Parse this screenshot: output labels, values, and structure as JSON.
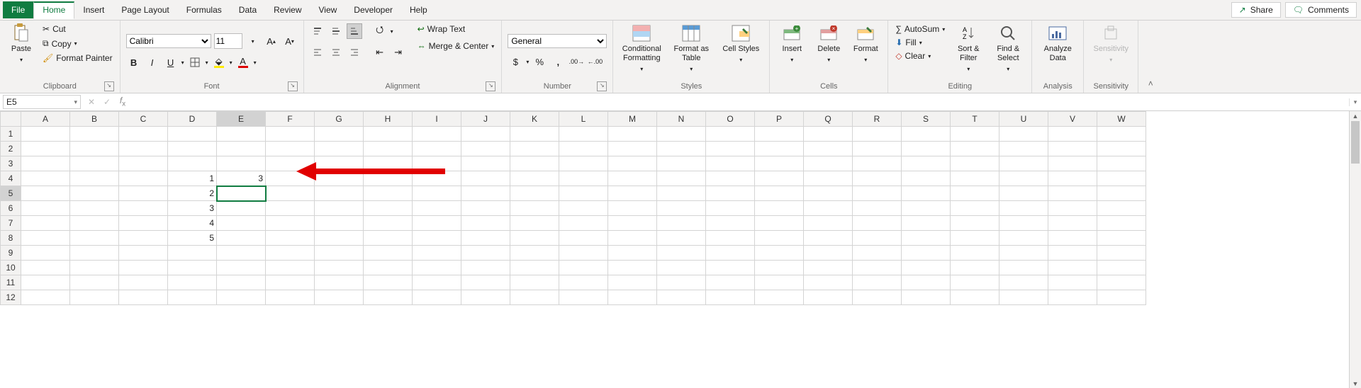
{
  "tabs": {
    "file": "File",
    "home": "Home",
    "insert": "Insert",
    "pagelayout": "Page Layout",
    "formulas": "Formulas",
    "data": "Data",
    "review": "Review",
    "view": "View",
    "developer": "Developer",
    "help": "Help"
  },
  "share": "Share",
  "comments": "Comments",
  "clipboard": {
    "paste": "Paste",
    "cut": "Cut",
    "copy": "Copy",
    "formatpainter": "Format Painter",
    "label": "Clipboard"
  },
  "font": {
    "name": "Calibri",
    "size": "11",
    "label": "Font"
  },
  "alignment": {
    "wrap": "Wrap Text",
    "merge": "Merge & Center",
    "label": "Alignment"
  },
  "number": {
    "format": "General",
    "label": "Number"
  },
  "styles": {
    "cond": "Conditional Formatting",
    "fat": "Format as Table",
    "cell": "Cell Styles",
    "label": "Styles"
  },
  "cells": {
    "insert": "Insert",
    "delete": "Delete",
    "format": "Format",
    "label": "Cells"
  },
  "editing": {
    "autosum": "AutoSum",
    "fill": "Fill",
    "clear": "Clear",
    "sort": "Sort & Filter",
    "find": "Find & Select",
    "label": "Editing"
  },
  "analysis": {
    "analyze": "Analyze Data",
    "label": "Analysis"
  },
  "sensitivity": {
    "btn": "Sensitivity",
    "label": "Sensitivity"
  },
  "namebox": "E5",
  "formula": "",
  "columns": [
    "A",
    "B",
    "C",
    "D",
    "E",
    "F",
    "G",
    "H",
    "I",
    "J",
    "K",
    "L",
    "M",
    "N",
    "O",
    "P",
    "Q",
    "R",
    "S",
    "T",
    "U",
    "V",
    "W"
  ],
  "rows": [
    "1",
    "2",
    "3",
    "4",
    "5",
    "6",
    "7",
    "8",
    "9",
    "10",
    "11",
    "12"
  ],
  "selected": {
    "row": 5,
    "col": "E"
  },
  "cellvalues": {
    "D4": "1",
    "D5": "2",
    "D6": "3",
    "D7": "4",
    "D8": "5",
    "E4": "3"
  },
  "chart_data": null
}
